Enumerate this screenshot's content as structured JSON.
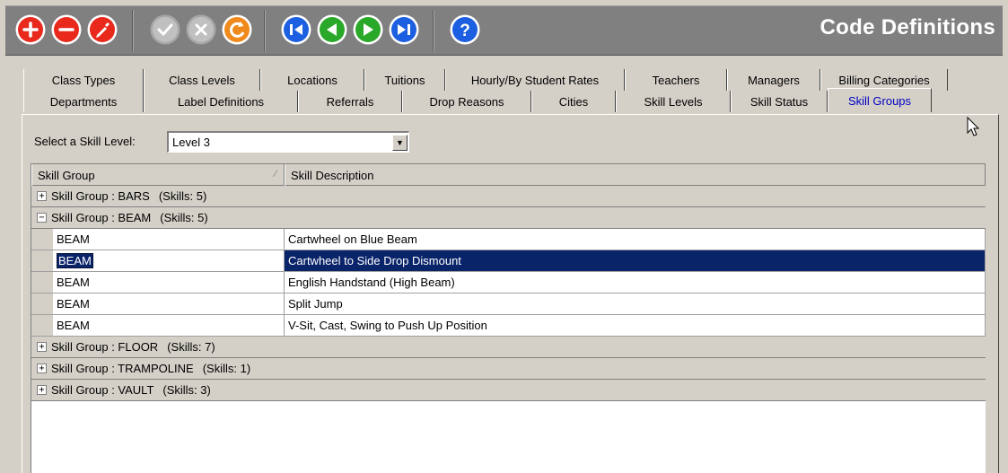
{
  "title": "Code Definitions",
  "toolbar": {
    "buttons": [
      {
        "icon": "add-icon",
        "color": "#e8291c"
      },
      {
        "icon": "remove-icon",
        "color": "#e8291c"
      },
      {
        "icon": "edit-icon",
        "color": "#e8291c"
      },
      {
        "icon": "save-icon",
        "color": "#c0c0c0"
      },
      {
        "icon": "cancel-icon",
        "color": "#c0c0c0"
      },
      {
        "icon": "refresh-icon",
        "color": "#f08a1c"
      },
      {
        "icon": "first-record-icon",
        "color": "#1c5fe0"
      },
      {
        "icon": "previous-record-icon",
        "color": "#2aa82a"
      },
      {
        "icon": "next-record-icon",
        "color": "#2aa82a"
      },
      {
        "icon": "last-record-icon",
        "color": "#1c5fe0"
      },
      {
        "icon": "help-icon",
        "color": "#1c5fe0"
      }
    ]
  },
  "tabs": {
    "back_row": [
      "Class Types",
      "Class Levels",
      "Locations",
      "Tuitions",
      "Hourly/By Student Rates",
      "Teachers",
      "Managers",
      "Billing Categories"
    ],
    "front_row": [
      "Departments",
      "Label Definitions",
      "Referrals",
      "Drop Reasons",
      "Cities",
      "Skill Levels",
      "Skill Status",
      "Skill Groups"
    ],
    "active": "Skill Groups"
  },
  "filter": {
    "label": "Select a Skill Level:",
    "value": "Level 3"
  },
  "grid": {
    "columns": [
      "Skill Group",
      "Skill Description"
    ],
    "groups": [
      {
        "prefix": "Skill Group : BARS",
        "count": "(Skills: 5)",
        "expanded": false,
        "rows": []
      },
      {
        "prefix": "Skill Group : BEAM",
        "count": "(Skills: 5)",
        "expanded": true,
        "rows": [
          {
            "group": "BEAM",
            "description": "Cartwheel on Blue Beam",
            "selected": false
          },
          {
            "group": "BEAM",
            "description": "Cartwheel to Side Drop Dismount",
            "selected": true
          },
          {
            "group": "BEAM",
            "description": "English Handstand (High Beam)",
            "selected": false
          },
          {
            "group": "BEAM",
            "description": "Split Jump",
            "selected": false
          },
          {
            "group": "BEAM",
            "description": "V-Sit, Cast, Swing to Push Up Position",
            "selected": false
          }
        ]
      },
      {
        "prefix": "Skill Group : FLOOR",
        "count": "(Skills: 7)",
        "expanded": false,
        "rows": []
      },
      {
        "prefix": "Skill Group : TRAMPOLINE",
        "count": "(Skills: 1)",
        "expanded": false,
        "rows": []
      },
      {
        "prefix": "Skill Group : VAULT",
        "count": "(Skills: 3)",
        "expanded": false,
        "rows": []
      }
    ]
  }
}
